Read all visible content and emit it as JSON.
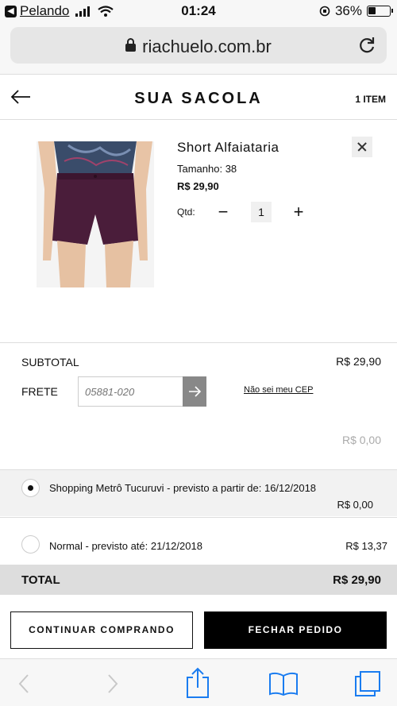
{
  "status_bar": {
    "carrier": "Pelando",
    "time": "01:24",
    "battery": "36%"
  },
  "browser": {
    "url": "riachuelo.com.br"
  },
  "header": {
    "title": "SUA SACOLA",
    "item_count": "1 ITEM"
  },
  "product": {
    "name": "Short Alfaiataria",
    "size": "Tamanho: 38",
    "price": "R$ 29,90",
    "qty_label": "Qtd:",
    "qty_minus": "−",
    "quantity": "1",
    "qty_plus": "+"
  },
  "summary": {
    "subtotal_label": "SUBTOTAL",
    "subtotal_value": "R$ 29,90",
    "frete_label": "FRETE",
    "cep_placeholder": "05881-020",
    "cep_link": "Não sei meu CEP",
    "frete_value": "R$ 0,00"
  },
  "shipping_options": [
    {
      "label": "Shopping Metrô Tucuruvi - previsto a partir de: 16/12/2018",
      "price": "R$ 0,00",
      "selected": true
    },
    {
      "label": "Normal - previsto até: 21/12/2018",
      "price": "R$ 13,37",
      "selected": false
    }
  ],
  "total": {
    "label": "TOTAL",
    "value": "R$ 29,90"
  },
  "actions": {
    "continue": "CONTINUAR COMPRANDO",
    "checkout": "FECHAR PEDIDO"
  },
  "icons": {
    "back": "back-arrow-icon",
    "remove": "close-icon",
    "reload": "reload-icon",
    "share": "share-icon",
    "bookmarks": "book-icon",
    "tabs": "tabs-icon"
  },
  "colors": {
    "primary": "#000000",
    "muted": "#aaaaaa",
    "selected_row_bg": "#f2f2f2",
    "total_bg": "#dddddd"
  }
}
